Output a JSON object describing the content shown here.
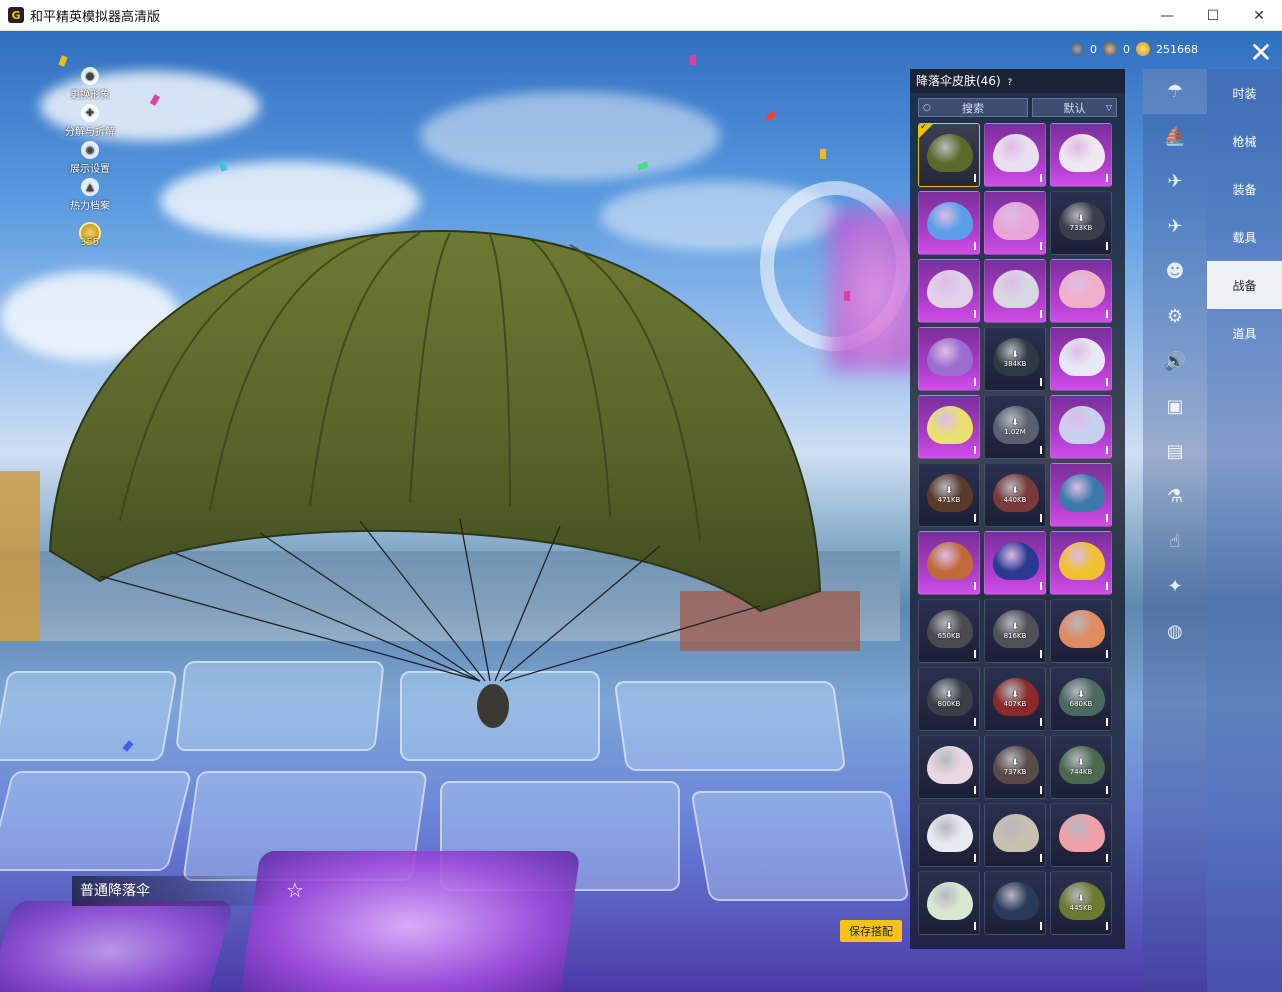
{
  "window": {
    "title": "和平精英模拟器高清版",
    "app_icon_glyph": "G",
    "minimize": "—",
    "maximize": "☐",
    "close": "✕"
  },
  "left_menu": {
    "items": [
      {
        "label": "更换形象",
        "icon": "person-icon"
      },
      {
        "label": "分解与拆解",
        "icon": "dismantle-icon"
      },
      {
        "label": "展示设置",
        "icon": "eye-icon"
      },
      {
        "label": "热力档案",
        "icon": "flame-icon"
      }
    ],
    "badge_value": "355"
  },
  "currency": {
    "c1": "0",
    "c2": "0",
    "c3": "251668"
  },
  "panel": {
    "title": "降落伞皮肤(46)",
    "help_glyph": "?",
    "search_label": "搜索",
    "sort_label": "默认",
    "items": [
      {
        "style": "normal",
        "color": "#5a6a2a",
        "selected": true
      },
      {
        "style": "purple",
        "color": "#e8e0f0"
      },
      {
        "style": "purple",
        "color": "#f0e8f0"
      },
      {
        "style": "purple",
        "color": "#5b9ee8"
      },
      {
        "style": "purple",
        "color": "#e6a6d8"
      },
      {
        "style": "dark",
        "color": "#3a3e4a",
        "size": "733KB"
      },
      {
        "style": "purple",
        "color": "#e0d0ea"
      },
      {
        "style": "purple",
        "color": "#d8d8e0"
      },
      {
        "style": "purple",
        "color": "#f0b0c8"
      },
      {
        "style": "purple",
        "color": "#9b6dd0"
      },
      {
        "style": "dark",
        "color": "#2f3a44",
        "size": "384KB"
      },
      {
        "style": "purple",
        "color": "#e8e8f6"
      },
      {
        "style": "purple",
        "color": "#e8e070"
      },
      {
        "style": "dark",
        "color": "#5a6070",
        "size": "1.02M"
      },
      {
        "style": "purple",
        "color": "#c8d0f0"
      },
      {
        "style": "dark",
        "color": "#5a3a2a",
        "size": "471KB"
      },
      {
        "style": "dark",
        "color": "#7a3a3a",
        "size": "440KB"
      },
      {
        "style": "purple",
        "color": "#3a7aa8"
      },
      {
        "style": "purple",
        "color": "#c06a3a"
      },
      {
        "style": "purple",
        "color": "#2a3a90"
      },
      {
        "style": "purple",
        "color": "#f0c030"
      },
      {
        "style": "dark",
        "color": "#4a4a50",
        "size": "650KB"
      },
      {
        "style": "dark",
        "color": "#505058",
        "size": "816KB"
      },
      {
        "style": "dark",
        "color": "#e08a60"
      },
      {
        "style": "dark",
        "color": "#3a3f48",
        "size": "800KB"
      },
      {
        "style": "dark",
        "color": "#8a2a2a",
        "size": "407KB"
      },
      {
        "style": "dark",
        "color": "#4a6a60",
        "size": "680KB"
      },
      {
        "style": "dark",
        "color": "#e8d8e0"
      },
      {
        "style": "dark",
        "color": "#5a4a4a",
        "size": "737KB"
      },
      {
        "style": "dark",
        "color": "#4a6a50",
        "size": "744KB"
      },
      {
        "style": "dark",
        "color": "#e8eaf2"
      },
      {
        "style": "dark",
        "color": "#c8c0b0"
      },
      {
        "style": "dark",
        "color": "#f0a0a8"
      },
      {
        "style": "dark",
        "color": "#d8e8d0"
      },
      {
        "style": "dark",
        "color": "#2a3a5a"
      },
      {
        "style": "dark",
        "color": "#6a7a30",
        "size": "445KB"
      }
    ]
  },
  "side_icons": [
    "parachute-icon",
    "boat-icon",
    "plane-icon",
    "jet-icon",
    "emote-icon",
    "robot-icon",
    "speaker-icon",
    "companion-icon",
    "photo-icon",
    "spray-icon",
    "hand-icon",
    "wand-icon",
    "gadget-icon"
  ],
  "side_icon_glyphs": [
    "☂",
    "⛵",
    "✈",
    "✈",
    "☻",
    "⚙",
    "🔊",
    "▣",
    "▤",
    "⚗",
    "☝",
    "✦",
    "◍"
  ],
  "categories": [
    "时装",
    "枪械",
    "装备",
    "载具",
    "战备",
    "道具"
  ],
  "active_category": 4,
  "item_name": "普通降落伞",
  "save_button": "保存搭配",
  "star_glyph": "☆",
  "close_glyph": "✕",
  "colors": {
    "accent": "#f5c217"
  }
}
